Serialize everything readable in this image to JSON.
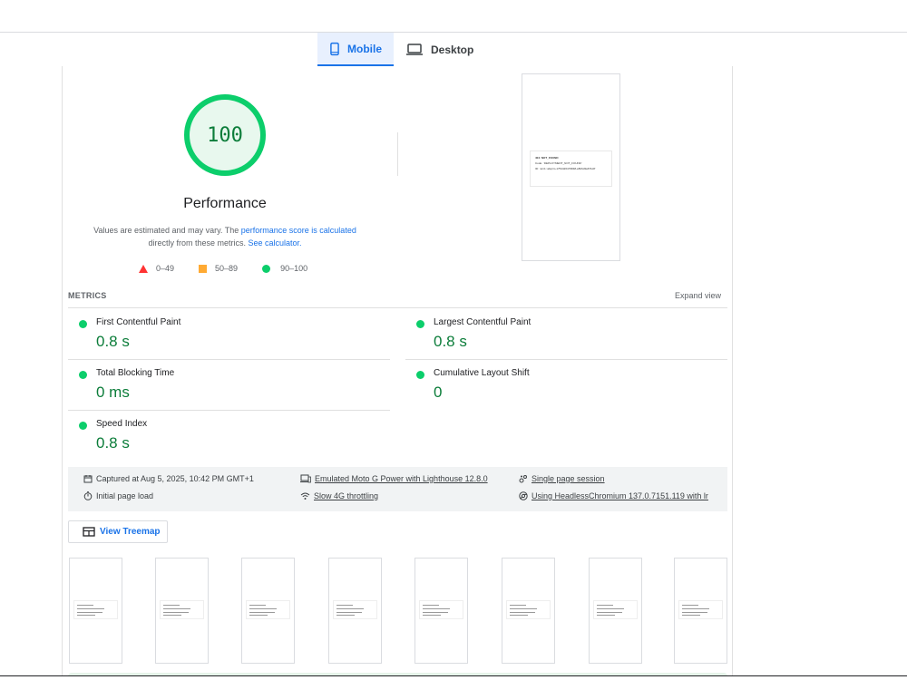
{
  "tabs": [
    {
      "label": "Mobile",
      "icon": "smartphone-icon",
      "active": true
    },
    {
      "label": "Desktop",
      "icon": "laptop-icon",
      "active": false
    }
  ],
  "score": {
    "value": "100",
    "fraction": 1.0,
    "category": "Performance",
    "color": "#0cce6b"
  },
  "description": {
    "prefix": "Values are estimated and may vary. The ",
    "link1": "performance score is calculated",
    "middle": " directly from these metrics. ",
    "link2": "See calculator."
  },
  "legend": [
    {
      "label": "0–49",
      "shape": "triangle",
      "color": "#ff3333"
    },
    {
      "label": "50–89",
      "shape": "square",
      "color": "#ffaa33"
    },
    {
      "label": "90–100",
      "shape": "circle",
      "color": "#0cce6b"
    }
  ],
  "screenshot_text": {
    "title": "404: NOT_FOUND",
    "code": "Code: `DEPLOYMENT_NOT_FOUND`",
    "id": "ID: `arn1::abqzm-1754426479848-a5b6d3a67bc8`"
  },
  "metrics": {
    "header": "METRICS",
    "expand_label": "Expand view",
    "items": [
      {
        "label": "First Contentful Paint",
        "value": "0.8 s"
      },
      {
        "label": "Largest Contentful Paint",
        "value": "0.8 s"
      },
      {
        "label": "Total Blocking Time",
        "value": "0 ms"
      },
      {
        "label": "Cumulative Layout Shift",
        "value": "0"
      },
      {
        "label": "Speed Index",
        "value": "0.8 s"
      }
    ]
  },
  "info": {
    "captured": "Captured at Aug 5, 2025, 10:42 PM GMT+1",
    "load": "Initial page load",
    "device": "Emulated Moto G Power with Lighthouse 12.8.0",
    "throttling": "Slow 4G throttling",
    "session": "Single page session",
    "browser": "Using HeadlessChromium 137.0.7151.119 with lr"
  },
  "treemap_label": "View Treemap"
}
